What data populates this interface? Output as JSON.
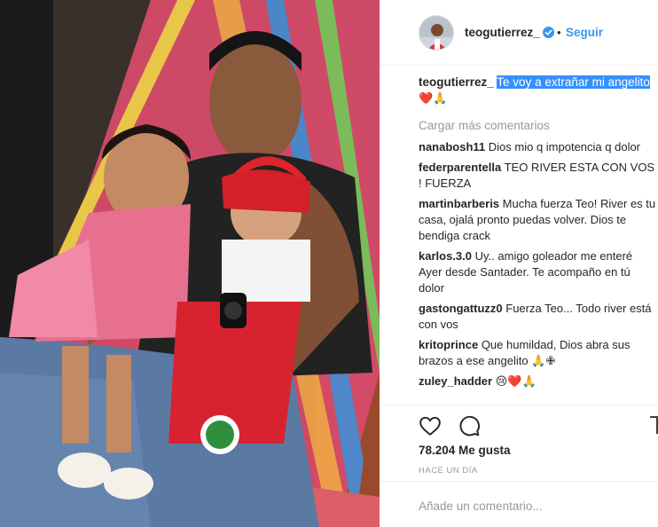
{
  "header": {
    "username": "teogutierrez_",
    "separator": "•",
    "follow_label": "Seguir"
  },
  "caption": {
    "username": "teogutierrez_",
    "text": "Te voy a extrañar mi angelito",
    "emojis": "❤️🙏"
  },
  "load_more": "Cargar más comentarios",
  "comments": [
    {
      "user": "nanabosh11",
      "text": "Dios mio q impotencia q dolor"
    },
    {
      "user": "federparentella",
      "text": "TEO RIVER ESTA CON VOS ! FUERZA"
    },
    {
      "user": "martinbarberis",
      "text": "Mucha fuerza Teo! River es tu casa, ojalá pronto puedas volver. Dios te bendiga crack"
    },
    {
      "user": "karlos.3.0",
      "text": "Uy.. amigo goleador me enteré Ayer desde Santader. Te acompaño en tú dolor"
    },
    {
      "user": "gastongattuzz0",
      "text": "Fuerza Teo... Todo river está con vos"
    },
    {
      "user": "kritoprince",
      "text": "Que humildad, Dios abra sus brazos a ese angelito 🙏✙"
    },
    {
      "user": "zuley_hadder",
      "text": "😢❤️🙏"
    }
  ],
  "likes": "78.204 Me gusta",
  "timestamp": "HACE UN DÍA",
  "add_comment_placeholder": "Añade un comentario...",
  "colors": {
    "accent": "#3897f0",
    "highlight": "#3390ff",
    "heart": "#ed4956"
  }
}
